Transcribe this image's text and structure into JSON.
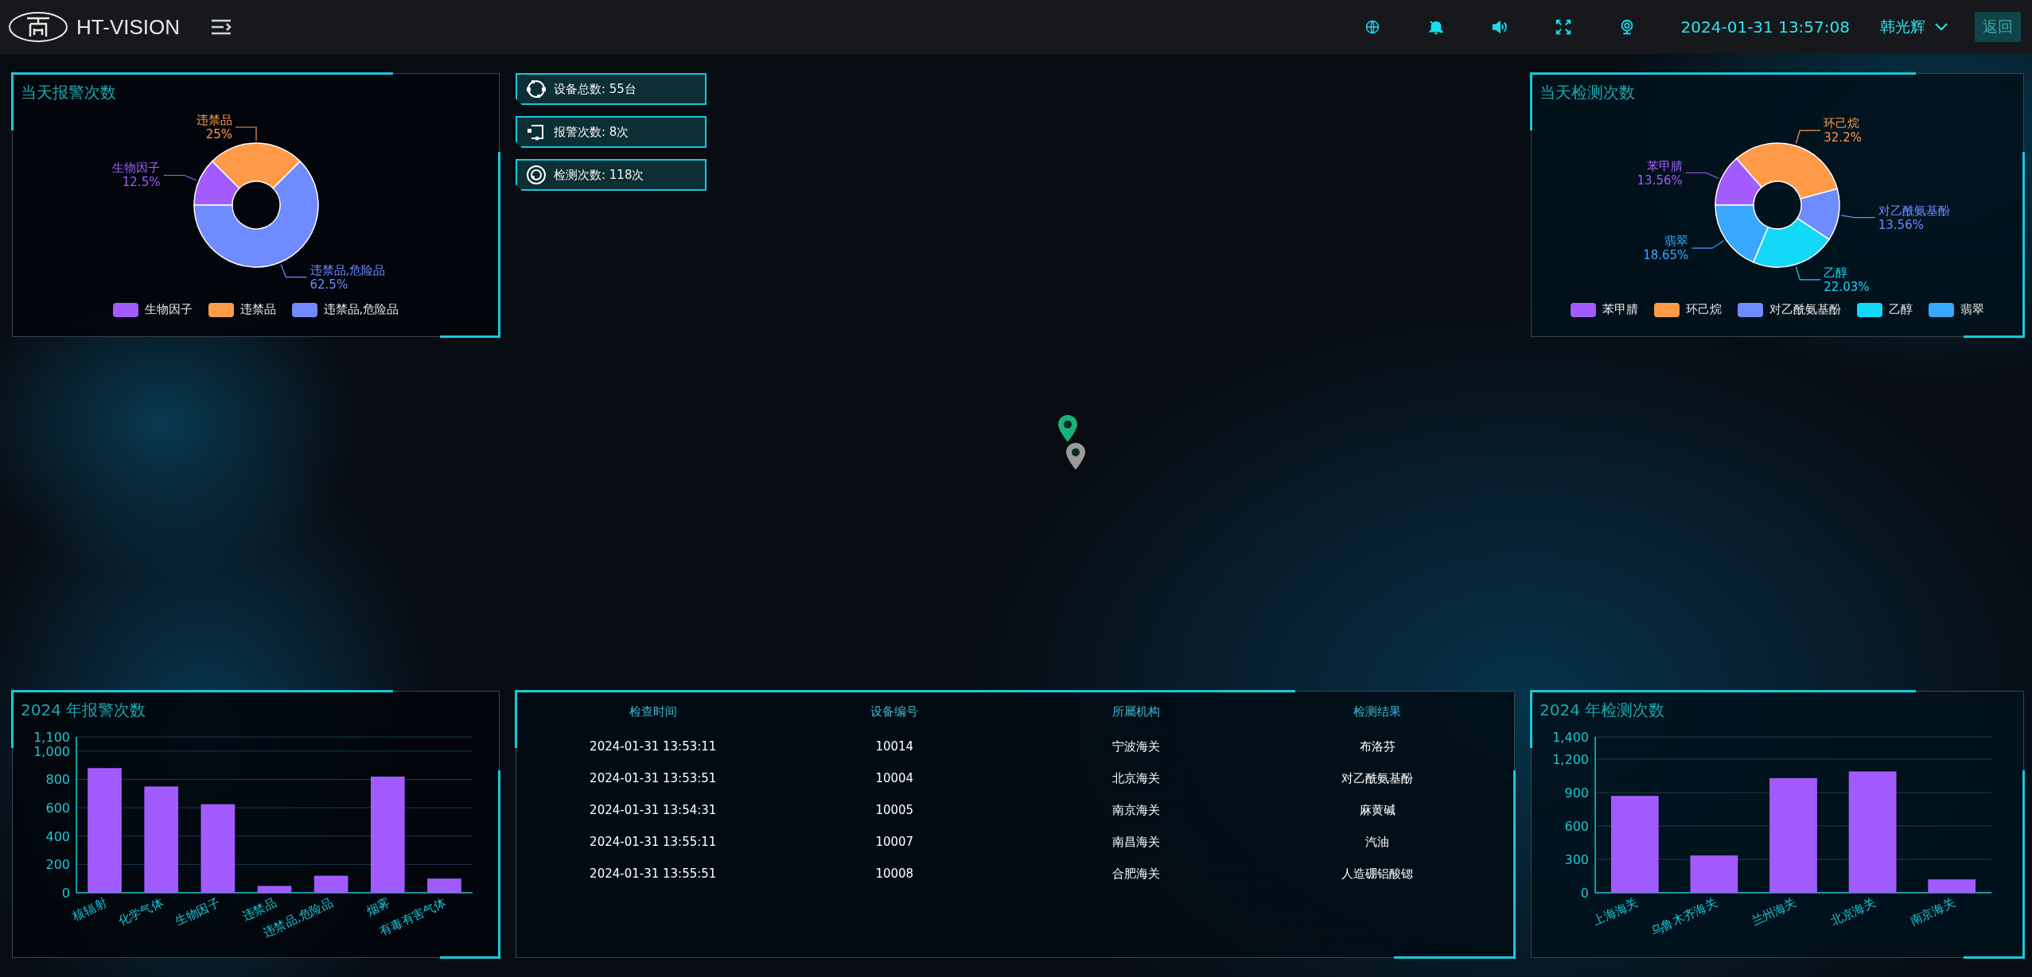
{
  "header": {
    "brand": "HT-VISION",
    "datetime": "2024-01-31 13:57:08",
    "user": "韩光辉",
    "back_button": "返回"
  },
  "stats": [
    {
      "label": "设备总数: 55台"
    },
    {
      "label": "报警次数: 8次"
    },
    {
      "label": "检测次数: 118次"
    }
  ],
  "alarm_today": {
    "chart_data": {
      "type": "donut",
      "title": "当天报警次数",
      "categories": [
        "生物因子",
        "违禁品",
        "违禁品,危险品"
      ],
      "values": [
        12.5,
        25,
        62.5
      ],
      "value_labels": [
        "12.5%",
        "25%",
        "62.5%"
      ]
    },
    "legend": [
      {
        "label": "生物因子",
        "color": "#a25bff"
      },
      {
        "label": "违禁品",
        "color": "#ff9a48"
      },
      {
        "label": "违禁品,危险品",
        "color": "#6e8bff"
      }
    ]
  },
  "detect_today": {
    "chart_data": {
      "type": "donut",
      "title": "当天检测次数",
      "categories": [
        "苯甲腈",
        "环己烷",
        "对乙酰氨基酚",
        "乙醇",
        "翡翠"
      ],
      "values": [
        13.56,
        32.2,
        13.56,
        22.03,
        18.65
      ],
      "value_labels": [
        "13.56%",
        "32.2%",
        "13.56%",
        "22.03%",
        "18.65%"
      ]
    },
    "legend": [
      {
        "label": "苯甲腈",
        "color": "#a25bff"
      },
      {
        "label": "环己烷",
        "color": "#ff9a48"
      },
      {
        "label": "对乙酰氨基酚",
        "color": "#6e8bff"
      },
      {
        "label": "乙醇",
        "color": "#13d8f7"
      },
      {
        "label": "翡翠",
        "color": "#38a8ff"
      }
    ]
  },
  "map_pins": [
    {
      "color": "#19b07a"
    },
    {
      "color": "#9a9a9a"
    }
  ],
  "alarm_year": {
    "chart_data": {
      "type": "bar",
      "title": "2024 年报警次数",
      "categories": [
        "核辐射",
        "化学气体",
        "生物因子",
        "违禁品",
        "违禁品,危险品",
        "烟雾",
        "有毒有害气体"
      ],
      "series": [
        {
          "color": "#a25bff",
          "values": [
            880,
            750,
            625,
            48,
            120,
            820,
            100
          ]
        }
      ],
      "ylim": [
        0,
        1100
      ],
      "grid": true,
      "yticks": [
        0,
        200,
        400,
        600,
        800,
        {
          "value": 1000,
          "label": "1,000"
        },
        {
          "value": 1100,
          "label": "1,100"
        }
      ]
    }
  },
  "detections_table": {
    "columns": [
      "检查时间",
      "设备编号",
      "所屬机构",
      "检测结果"
    ],
    "rows": [
      [
        "2024-01-31 13:53:11",
        "10014",
        "宁波海关",
        "布洛芬"
      ],
      [
        "2024-01-31 13:53:51",
        "10004",
        "北京海关",
        "对乙酰氨基酚"
      ],
      [
        "2024-01-31 13:54:31",
        "10005",
        "南京海关",
        "麻黄碱"
      ],
      [
        "2024-01-31 13:55:11",
        "10007",
        "南昌海关",
        "汽油"
      ],
      [
        "2024-01-31 13:55:51",
        "10008",
        "合肥海关",
        "人造硼铝酸锶"
      ]
    ]
  },
  "detect_year": {
    "chart_data": {
      "type": "bar",
      "title": "2024 年检测次数",
      "categories": [
        "上海海关",
        "乌鲁木齐海关",
        "兰州海关",
        "北京海关",
        "南京海关"
      ],
      "series": [
        {
          "color": "#a25bff",
          "values": [
            870,
            335,
            1030,
            1090,
            120
          ]
        }
      ],
      "ylim": [
        0,
        1400
      ],
      "grid": true,
      "yticks": [
        0,
        300,
        600,
        900,
        {
          "value": 1200,
          "label": "1,200"
        },
        {
          "value": 1400,
          "label": "1,400"
        }
      ]
    }
  }
}
